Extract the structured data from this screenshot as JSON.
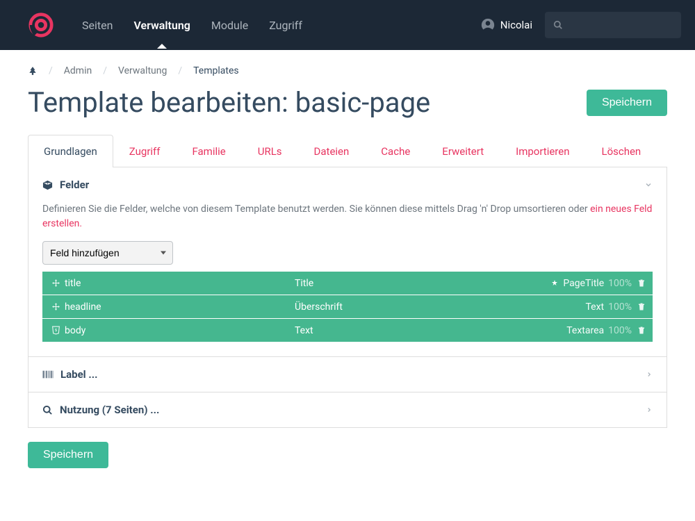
{
  "nav": {
    "items": [
      "Seiten",
      "Verwaltung",
      "Module",
      "Zugriff"
    ],
    "active": 1
  },
  "user": {
    "name": "Nicolai"
  },
  "search": {
    "placeholder": ""
  },
  "breadcrumb": {
    "admin": "Admin",
    "verwaltung": "Verwaltung",
    "templates": "Templates"
  },
  "page": {
    "title": "Template bearbeiten: basic-page"
  },
  "buttons": {
    "save": "Speichern"
  },
  "tabs": [
    "Grundlagen",
    "Zugriff",
    "Familie",
    "URLs",
    "Dateien",
    "Cache",
    "Erweitert",
    "Importieren",
    "Löschen"
  ],
  "tabs_active": 0,
  "felder": {
    "title": "Felder",
    "help_pre": "Definieren Sie die Felder, welche von diesem Template benutzt werden. Sie können diese mittels Drag 'n' Drop umsortieren oder ",
    "help_link": "ein neues Feld erstellen.",
    "add_label": "Feld hinzufügen",
    "rows": [
      {
        "icon": "move",
        "name": "title",
        "label": "Title",
        "type": "PageTitle",
        "pct": "100%",
        "plugin": true
      },
      {
        "icon": "move",
        "name": "headline",
        "label": "Überschrift",
        "type": "Text",
        "pct": "100%",
        "plugin": false
      },
      {
        "icon": "html",
        "name": "body",
        "label": "Text",
        "type": "Textarea",
        "pct": "100%",
        "plugin": false
      }
    ]
  },
  "label_section": {
    "title": "Label ..."
  },
  "usage_section": {
    "title": "Nutzung (7 Seiten) ..."
  }
}
